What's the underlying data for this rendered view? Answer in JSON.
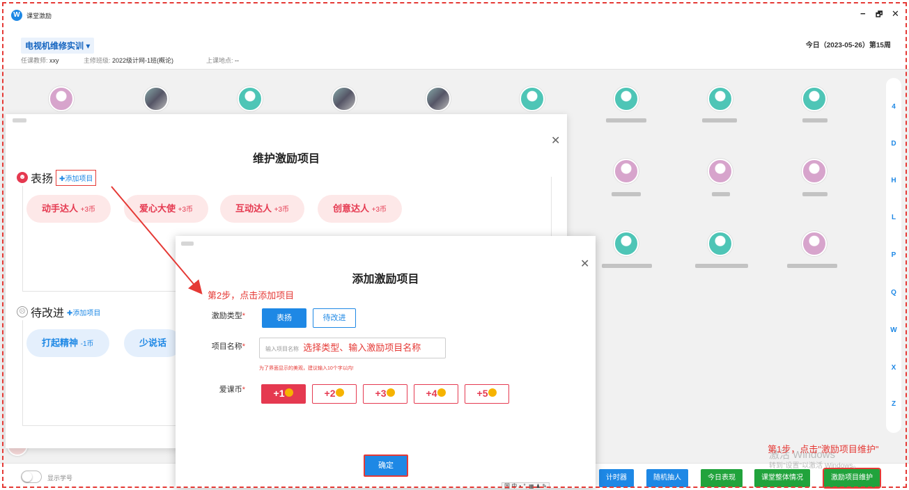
{
  "window": {
    "title": "课堂激励",
    "logo": "W",
    "ctrl_min": "−",
    "ctrl_restore": "🗗",
    "ctrl_close": "✕"
  },
  "header": {
    "course": "电视机维修实训 ▾",
    "teacher_label": "任课教师:",
    "teacher": "xxy",
    "class_label": "主修班级:",
    "class": "2022级计网-1班(概论)",
    "place_label": "上课地点:",
    "place": "--",
    "today": "今日（2023-05-26）第15周"
  },
  "letters": [
    "4",
    "D",
    "H",
    "L",
    "P",
    "Q",
    "W",
    "X",
    "Z"
  ],
  "bottom": {
    "toggle_label": "显示学号",
    "buttons": [
      "计时器",
      "随机抽人",
      "今日表现",
      "课堂整体情况",
      "激励项目维护"
    ]
  },
  "colors": {
    "blue": "#1e88e5",
    "green": "#21a33c",
    "red": "#e53950"
  },
  "annotations": {
    "step1": "第1步，点击\"激励项目维护\"",
    "step2": "第2步，点击添加项目",
    "input_hint": "选择类型、输入激励项目名称"
  },
  "watermark": {
    "line1": "激活 Windows",
    "line2": "转到\"设置\"以激活 Windows。"
  },
  "dialog1": {
    "title": "维护激励项目",
    "praise": {
      "title": "表扬",
      "add": "✚添加项目",
      "items": [
        {
          "name": "动手达人",
          "coin": "+3币"
        },
        {
          "name": "爱心大使",
          "coin": "+3币"
        },
        {
          "name": "互动达人",
          "coin": "+3币"
        },
        {
          "name": "创意达人",
          "coin": "+3币"
        }
      ]
    },
    "improve": {
      "title": "待改进",
      "add": "✚添加项目",
      "items": [
        {
          "name": "打起精神",
          "coin": "-1币"
        },
        {
          "name": "少说话",
          "coin": ""
        }
      ]
    }
  },
  "dialog2": {
    "title": "添加激励项目",
    "type_label": "激励类型",
    "type_options": [
      "表扬",
      "待改进"
    ],
    "name_label": "项目名称",
    "name_placeholder": "输入项目名称",
    "name_tip": "为了界面显示的美观，建议输入10个字以内!",
    "coin_label": "爱课币",
    "coin_options": [
      "+1",
      "+2",
      "+3",
      "+4",
      "+5"
    ],
    "confirm": "确定"
  },
  "ime": "国 中 ◗ °, ▦ ♟ ✎"
}
